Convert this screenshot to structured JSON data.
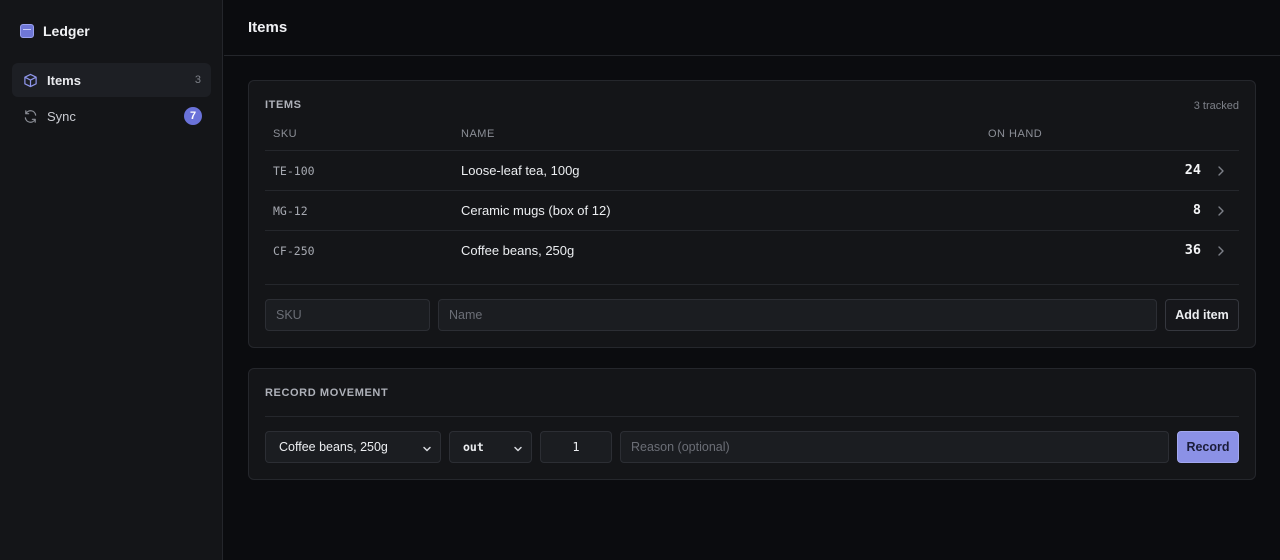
{
  "app": {
    "name": "Ledger"
  },
  "sidebar": {
    "items": [
      {
        "label": "Items",
        "count": "3",
        "icon": "cube-icon",
        "active": true
      },
      {
        "label": "Sync",
        "badge": "7",
        "icon": "refresh-icon",
        "active": false
      }
    ]
  },
  "header": {
    "title": "Items"
  },
  "items_card": {
    "title": "ITEMS",
    "meta": "3 tracked",
    "columns": {
      "sku": "SKU",
      "name": "NAME",
      "on_hand": "ON HAND"
    },
    "rows": [
      {
        "sku": "TE-100",
        "name": "Loose-leaf tea, 100g",
        "qty": "24"
      },
      {
        "sku": "MG-12",
        "name": "Ceramic mugs (box of 12)",
        "qty": "8"
      },
      {
        "sku": "CF-250",
        "name": "Coffee beans, 250g",
        "qty": "36"
      }
    ],
    "form": {
      "sku_placeholder": "SKU",
      "name_placeholder": "Name",
      "add_label": "Add item"
    }
  },
  "movement_card": {
    "title": "RECORD MOVEMENT",
    "item_select": "Coffee beans, 250g",
    "direction_select": "out",
    "quantity": "1",
    "reason_placeholder": "Reason (optional)",
    "record_label": "Record"
  },
  "colors": {
    "accent": "#6a72d9",
    "record_button": "#8b91e6",
    "background": "#0b0c0f",
    "panel": "#141518"
  }
}
